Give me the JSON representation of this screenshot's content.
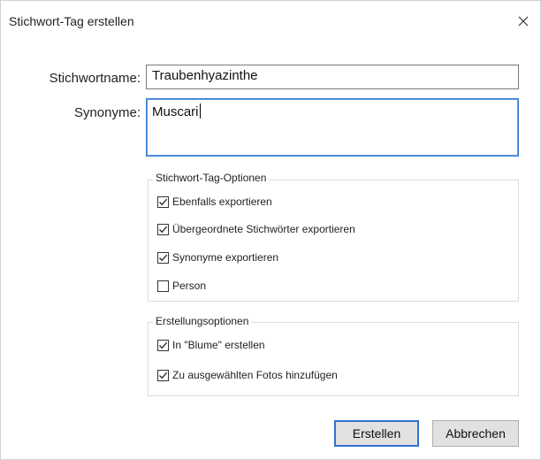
{
  "dialog": {
    "title": "Stichwort-Tag erstellen",
    "close_icon": "close-icon"
  },
  "fields": {
    "name_label": "Stichwortname:",
    "name_value": "Traubenhyazinthe",
    "synonyms_label": "Synonyme:",
    "synonyms_value": "Muscari"
  },
  "tag_options": {
    "legend": "Stichwort-Tag-Optionen",
    "items": [
      {
        "label": "Ebenfalls exportieren",
        "checked": true
      },
      {
        "label": "Übergeordnete Stichwörter exportieren",
        "checked": true
      },
      {
        "label": "Synonyme exportieren",
        "checked": true
      },
      {
        "label": "Person",
        "checked": false
      }
    ]
  },
  "create_options": {
    "legend": "Erstellungsoptionen",
    "items": [
      {
        "label": "In \"Blume\" erstellen",
        "checked": true
      },
      {
        "label": "Zu ausgewählten Fotos hinzufügen",
        "checked": true
      }
    ]
  },
  "buttons": {
    "create": "Erstellen",
    "cancel": "Abbrechen"
  },
  "colors": {
    "accent": "#2f73d0",
    "button_bg": "#e1e1e1"
  }
}
